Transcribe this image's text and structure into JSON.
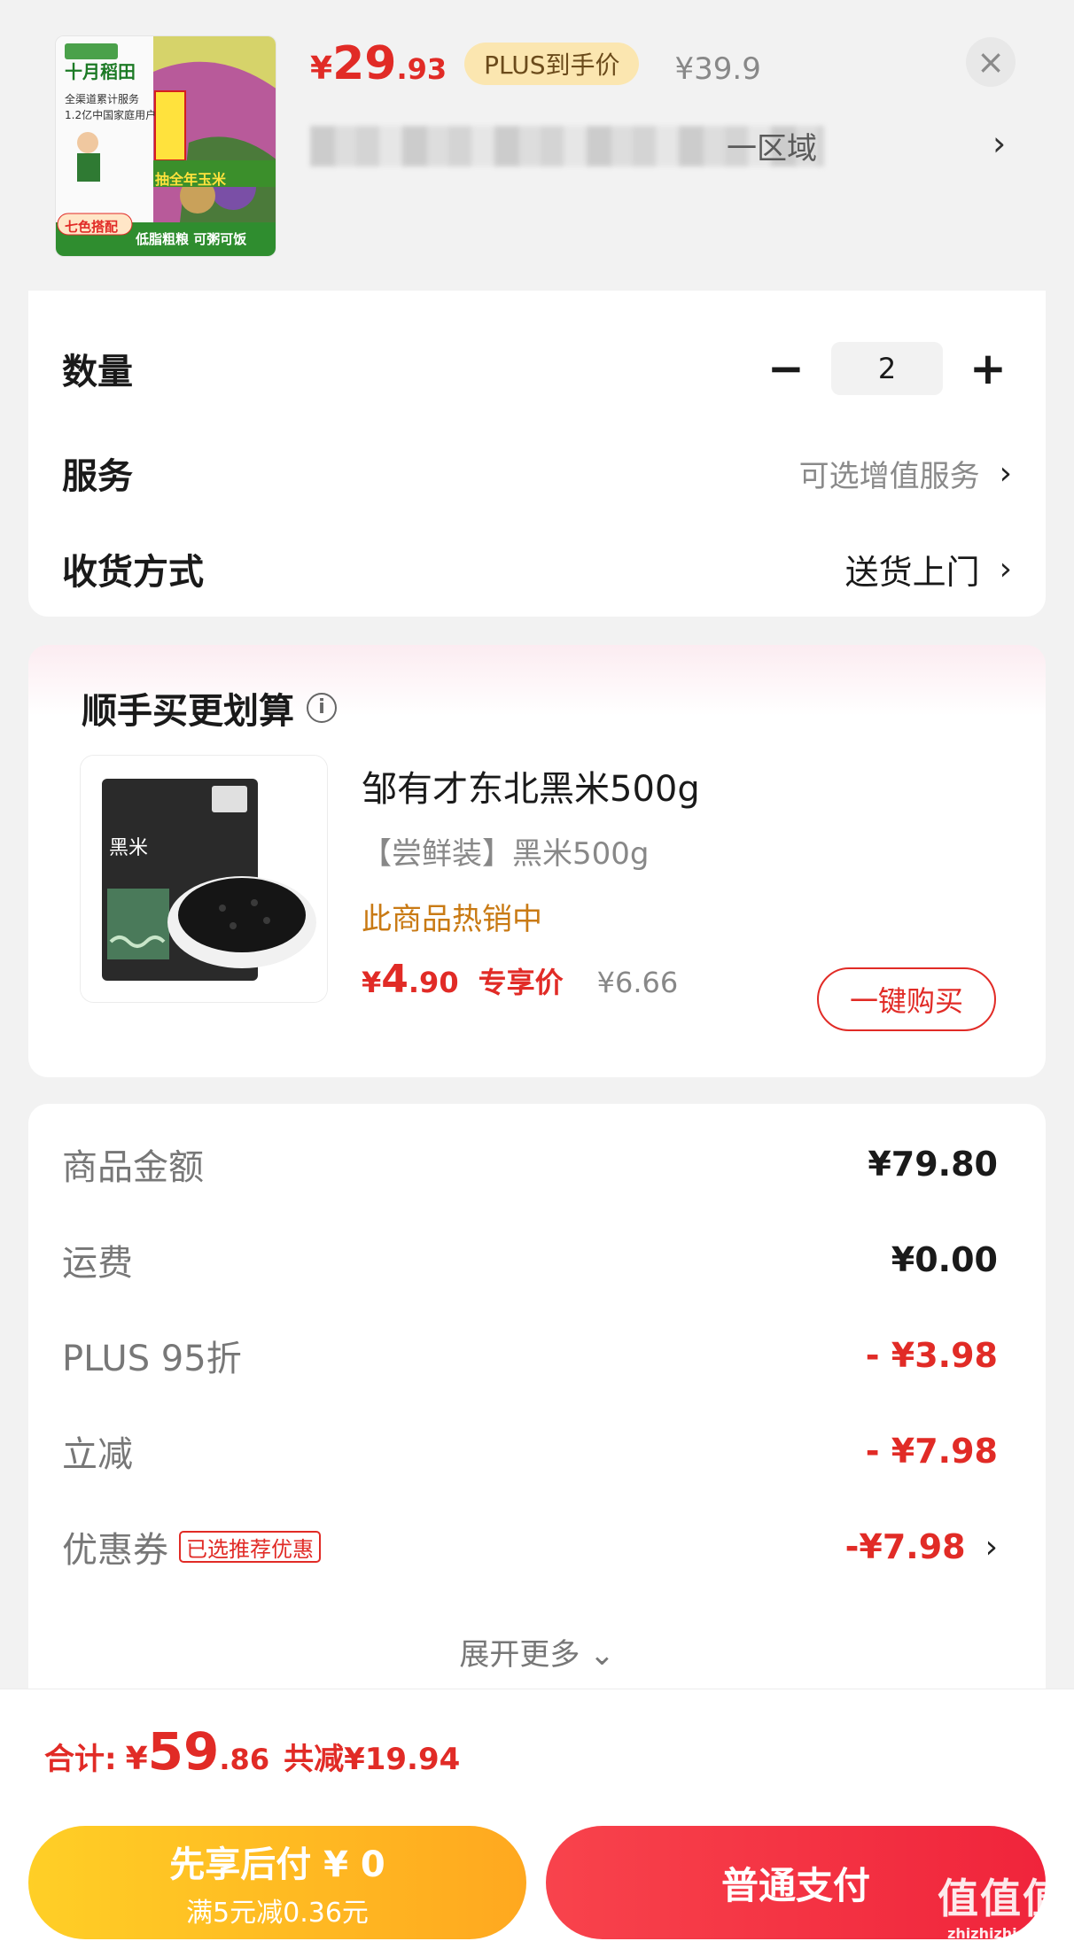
{
  "product": {
    "thumb_badge_brand": "十月稻田",
    "thumb_line1": "全渠道累计服务",
    "thumb_line2": "1.2亿中国家庭用户",
    "thumb_promo": "抽全年玉米",
    "thumb_tag_left": "七色搭配",
    "thumb_tag_bottom": "低脂粗粮 可粥可饭",
    "price_currency": "¥",
    "price_integer": "29",
    "price_decimal": ".93",
    "plus_label": "PLUS到手价",
    "original_price": "¥39.9",
    "close_icon": "close-icon",
    "address_suffix": "一区域",
    "address_chevron": "›"
  },
  "options": {
    "quantity_label": "数量",
    "quantity_value": "2",
    "minus": "−",
    "plus": "+",
    "service_label": "服务",
    "service_value": "可选增值服务",
    "delivery_label": "收货方式",
    "delivery_value": "送货上门",
    "chevron": "›"
  },
  "recommend": {
    "title": "顺手买更划算",
    "info_icon": "i",
    "item_name": "邹有才东北黑米500g",
    "item_spec": "【尝鲜装】黑米500g",
    "item_status": "此商品热销中",
    "price_currency": "¥",
    "price_integer": "4",
    "price_decimal": ".90",
    "price_tag": "专享价",
    "original_price": "¥6.66",
    "buy_label": "一键购买",
    "package_label": "黑米"
  },
  "summary": {
    "rows": [
      {
        "label": "商品金额",
        "value": "¥79.80"
      },
      {
        "label": "运费",
        "value": "¥0.00"
      },
      {
        "label": "PLUS 95折",
        "value": "- ¥3.98"
      },
      {
        "label": "立减",
        "value": "- ¥7.98"
      },
      {
        "label": "优惠券",
        "value": "-¥7.98"
      }
    ],
    "coupon_tag": "已选推荐优惠",
    "expand_label": "展开更多 ⌄"
  },
  "footer": {
    "total_label": "合计:",
    "total_currency": "¥",
    "total_integer": "59",
    "total_decimal": ".86",
    "total_saved": "共减¥19.94",
    "pay_later_title": "先享后付 ¥ 0",
    "pay_later_sub": "满5元减0.36元",
    "pay_normal": "普通支付",
    "watermark_main": "值值值",
    "watermark_sub": "zhizhizhi.com"
  },
  "colors": {
    "accent_red": "#e12b26",
    "plus_gold": "#fbe6b0",
    "pay_later_yellow": "#ffb81f",
    "pay_normal_red": "#f0243b"
  }
}
